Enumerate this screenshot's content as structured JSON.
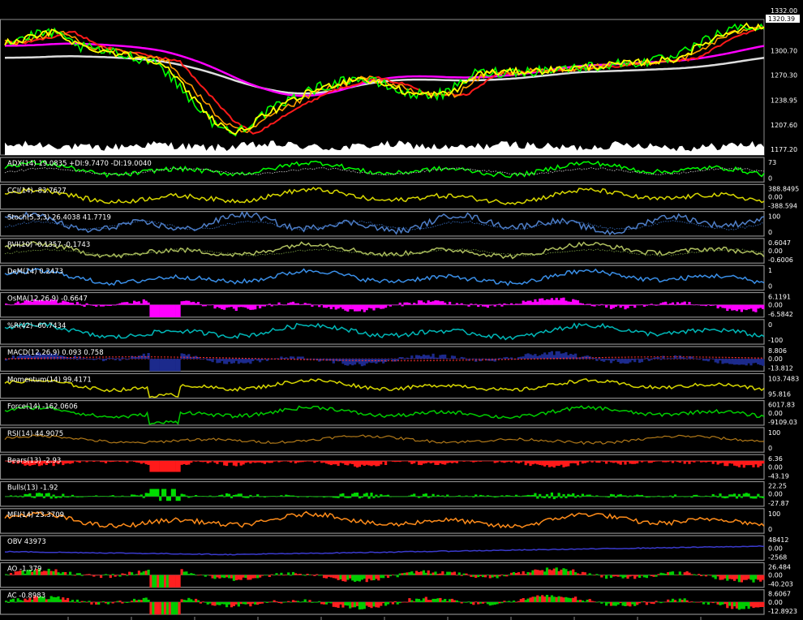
{
  "colors": {
    "background": "#000000",
    "frame": "#8c8c8c",
    "separator": "#8a8a8a",
    "price_fast": "#ffff00",
    "price_mid": "#ff9a00",
    "price_green": "#00ff00",
    "price_red": "#ff1a1a",
    "price_magenta": "#ff00ff",
    "price_slow": "#dddddd"
  },
  "chart_data": [
    {
      "type": "line",
      "title": "",
      "series": [],
      "y_ticks": [
        "1177.20",
        "1207.60",
        "1238.95",
        "1270.30",
        "1300.70"
      ],
      "ylim": [
        1170,
        1340
      ],
      "price_tag": "1320.39",
      "top_label": "1332.00",
      "volume": true
    },
    {
      "type": "line",
      "title": "ADX(14) 19.0835 +DI:9.7470 -DI:19.0040",
      "y_ticks": [
        "73",
        "0"
      ],
      "color": "#00ff00",
      "style": "adx"
    },
    {
      "type": "line",
      "title": "CCI(14) -83.7627",
      "y_ticks": [
        "388.8495",
        "0.00",
        "-388.594"
      ],
      "color": "#d8d800",
      "style": "osc"
    },
    {
      "type": "line",
      "title": "Stoch(5,3,3) 26.4038 41.7719",
      "y_ticks": [
        "100",
        "0"
      ],
      "color": "#4f7fc8",
      "style": "stoch"
    },
    {
      "type": "line",
      "title": "RVI(10) -0.1357 -0.1743",
      "y_ticks": [
        "0.6047",
        "0.00",
        "-0.6006"
      ],
      "color": "#b0c060",
      "style": "rvi"
    },
    {
      "type": "line",
      "title": "DeM(14) 0.2473",
      "y_ticks": [
        "1",
        "0"
      ],
      "color": "#3a8fe8",
      "style": "osc"
    },
    {
      "type": "bar",
      "title": "OsMA(12,26,9) -0.6647",
      "y_ticks": [
        "6.1191",
        "0.00",
        "-6.5842"
      ],
      "color": "#ff00ff",
      "style": "hist"
    },
    {
      "type": "line",
      "title": "%R(42) -60.7434",
      "y_ticks": [
        "0",
        "-100"
      ],
      "color": "#00b8b8",
      "style": "wpr"
    },
    {
      "type": "bar",
      "title": "MACD(12,26,9) 0.093 0.758",
      "y_ticks": [
        "8.806",
        "0.00",
        "-13.812"
      ],
      "color": "#1c2a8c",
      "style": "macd"
    },
    {
      "type": "line",
      "title": "Momentum(14) 99.4171",
      "y_ticks": [
        "103.7483",
        "95.816"
      ],
      "color": "#d8d800",
      "style": "mom"
    },
    {
      "type": "line",
      "title": "Force(14) -162.0606",
      "y_ticks": [
        "6017.83",
        "0.00",
        "-9109.03"
      ],
      "color": "#00cc00",
      "style": "mom"
    },
    {
      "type": "line",
      "title": "RSI(14) 44.9075",
      "y_ticks": [
        "100",
        "0"
      ],
      "color": "#b07818",
      "style": "flat"
    },
    {
      "type": "bar",
      "title": "Bears(13) -2.93",
      "y_ticks": [
        "6.36",
        "0.00",
        "-43.19"
      ],
      "color": "#ff1a1a",
      "style": "bears"
    },
    {
      "type": "bar",
      "title": "Bulls(13) -1.92",
      "y_ticks": [
        "22.25",
        "0.00",
        "-27.87"
      ],
      "color": "#00dd00",
      "style": "bulls"
    },
    {
      "type": "line",
      "title": "MFI(14) 23.3709",
      "y_ticks": [
        "100",
        "0"
      ],
      "color": "#ff8c1a",
      "style": "osc"
    },
    {
      "type": "line",
      "title": "OBV 43973",
      "y_ticks": [
        "48412",
        "0.00",
        "-2568"
      ],
      "color": "#3a3acc",
      "style": "obv"
    },
    {
      "type": "bar",
      "title": "AO -1.379",
      "y_ticks": [
        "26.484",
        "0.00",
        "-40.203"
      ],
      "color": "#00cc00",
      "style": "ao"
    },
    {
      "type": "bar",
      "title": "AC -0.8983",
      "y_ticks": [
        "8.6067",
        "0.00",
        "-12.8923"
      ],
      "color": "#00cc00",
      "style": "ac"
    }
  ]
}
